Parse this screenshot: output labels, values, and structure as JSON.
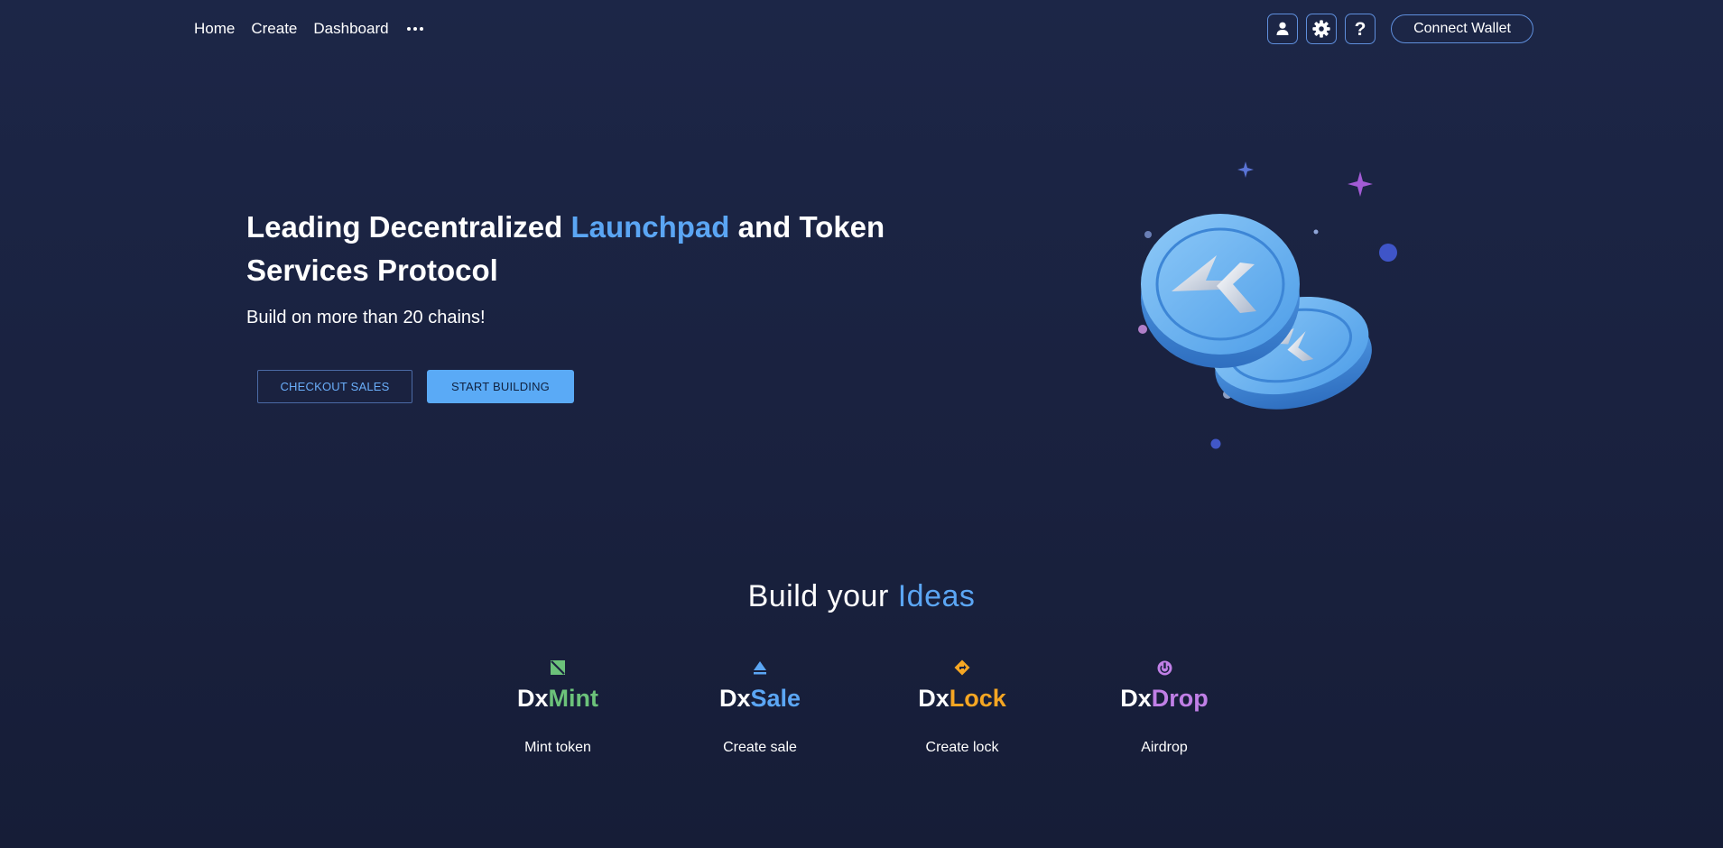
{
  "nav": {
    "links": [
      "Home",
      "Create",
      "Dashboard"
    ],
    "more_icon": "more-dots-icon",
    "account_icon": "user-icon",
    "settings_icon": "gear-icon",
    "help_label": "?",
    "connect_label": "Connect Wallet"
  },
  "hero": {
    "title_part1": "Leading Decentralized ",
    "title_accent": "Launchpad",
    "title_part2": " and Token Services Protocol",
    "subtitle": "Build on more than 20 chains!",
    "button_outline": "CHECKOUT SALES",
    "button_solid": "START BUILDING",
    "illustration": "coins-illustration"
  },
  "build": {
    "title_part1": "Build your ",
    "title_accent": "Ideas",
    "features": [
      {
        "prefix": "Dx",
        "name": "Mint",
        "caption": "Mint token",
        "color": "#6cc27a",
        "icon": "mint-icon"
      },
      {
        "prefix": "Dx",
        "name": "Sale",
        "caption": "Create sale",
        "color": "#5ba6f4",
        "icon": "sale-icon"
      },
      {
        "prefix": "Dx",
        "name": "Lock",
        "caption": "Create lock",
        "color": "#f5a623",
        "icon": "lock-icon"
      },
      {
        "prefix": "Dx",
        "name": "Drop",
        "caption": "Airdrop",
        "color": "#c07fe6",
        "icon": "drop-icon"
      }
    ]
  },
  "colors": {
    "background": "#1a2240",
    "accent": "#5ba6f4",
    "button_fill": "#5aaaf6",
    "border": "#5f8fdc"
  }
}
